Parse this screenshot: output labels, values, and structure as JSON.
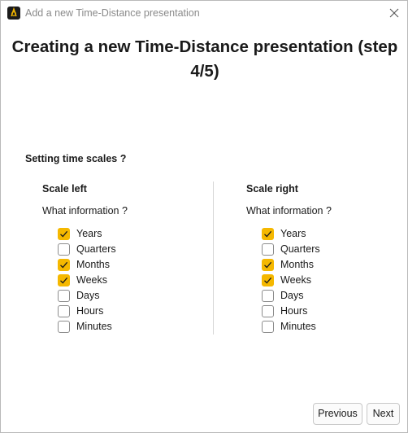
{
  "window": {
    "title": "Add a new Time-Distance presentation"
  },
  "heading": "Creating a new Time-Distance presentation (step 4/5)",
  "section_title": "Setting time scales ?",
  "columns": [
    {
      "title": "Scale left",
      "question": "What information ?",
      "options": [
        {
          "label": "Years",
          "checked": true
        },
        {
          "label": "Quarters",
          "checked": false
        },
        {
          "label": "Months",
          "checked": true
        },
        {
          "label": "Weeks",
          "checked": true
        },
        {
          "label": "Days",
          "checked": false
        },
        {
          "label": "Hours",
          "checked": false
        },
        {
          "label": "Minutes",
          "checked": false
        }
      ]
    },
    {
      "title": "Scale right",
      "question": "What information ?",
      "options": [
        {
          "label": "Years",
          "checked": true
        },
        {
          "label": "Quarters",
          "checked": false
        },
        {
          "label": "Months",
          "checked": true
        },
        {
          "label": "Weeks",
          "checked": true
        },
        {
          "label": "Days",
          "checked": false
        },
        {
          "label": "Hours",
          "checked": false
        },
        {
          "label": "Minutes",
          "checked": false
        }
      ]
    }
  ],
  "buttons": {
    "previous": "Previous",
    "next": "Next"
  },
  "colors": {
    "checkbox_accent": "#f5b800",
    "app_icon_bg": "#1b1b1b"
  },
  "icons": {
    "app": "app-logo-icon",
    "close": "close-icon",
    "check": "checkmark-icon"
  }
}
